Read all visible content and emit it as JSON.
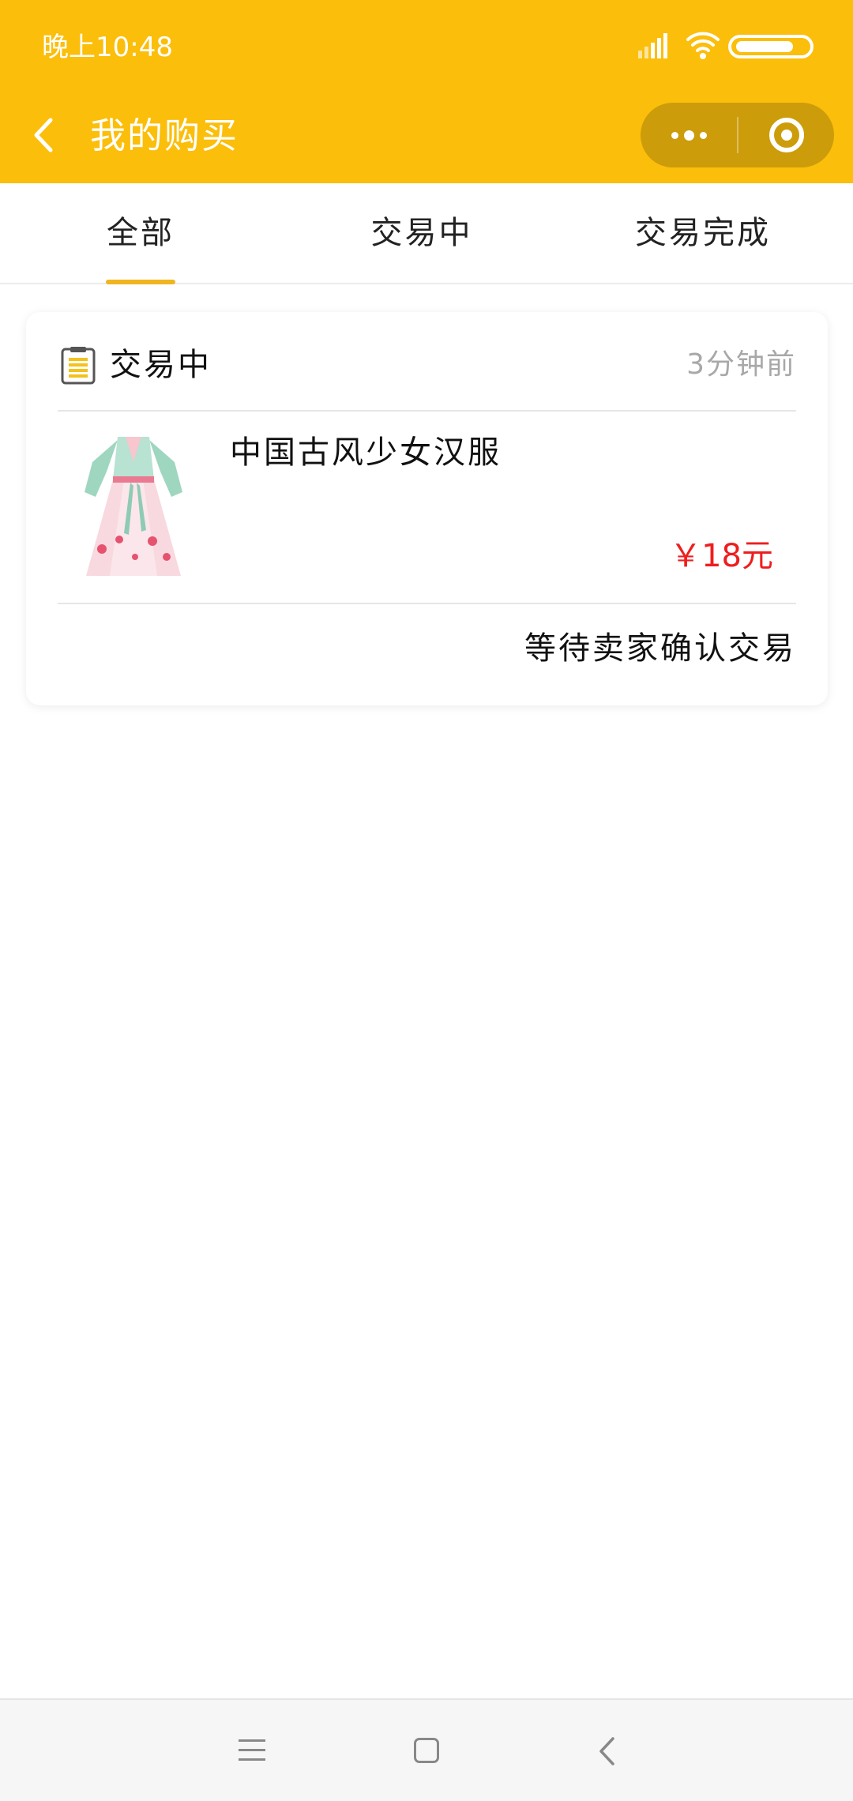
{
  "status_bar": {
    "time": "晚上10:48",
    "signal_icon": "signal-icon",
    "wifi_icon": "wifi-icon",
    "battery_icon": "battery-icon"
  },
  "nav_bar": {
    "title": "我的购买",
    "back_icon": "back-arrow-icon",
    "more_icon": "more-dots-icon",
    "close_icon": "miniprogram-close-icon",
    "background": "#FBBE0A"
  },
  "tabs": [
    {
      "label": "全部",
      "selected": true
    },
    {
      "label": "交易中",
      "selected": false
    },
    {
      "label": "交易完成",
      "selected": false
    }
  ],
  "accent_color": "#F0B51F",
  "order": {
    "status": "交易中",
    "time_ago": "3分钟前",
    "product_name": "中国古风少女汉服",
    "price": "￥18元",
    "price_color": "#EE1E1E",
    "footer_status": "等待卖家确认交易",
    "status_icon": "document-icon",
    "product_image": "hanfu-dress-image"
  },
  "system_nav": {
    "menu_icon": "menu-icon",
    "home_icon": "home-square-icon",
    "back_icon": "system-back-icon"
  }
}
